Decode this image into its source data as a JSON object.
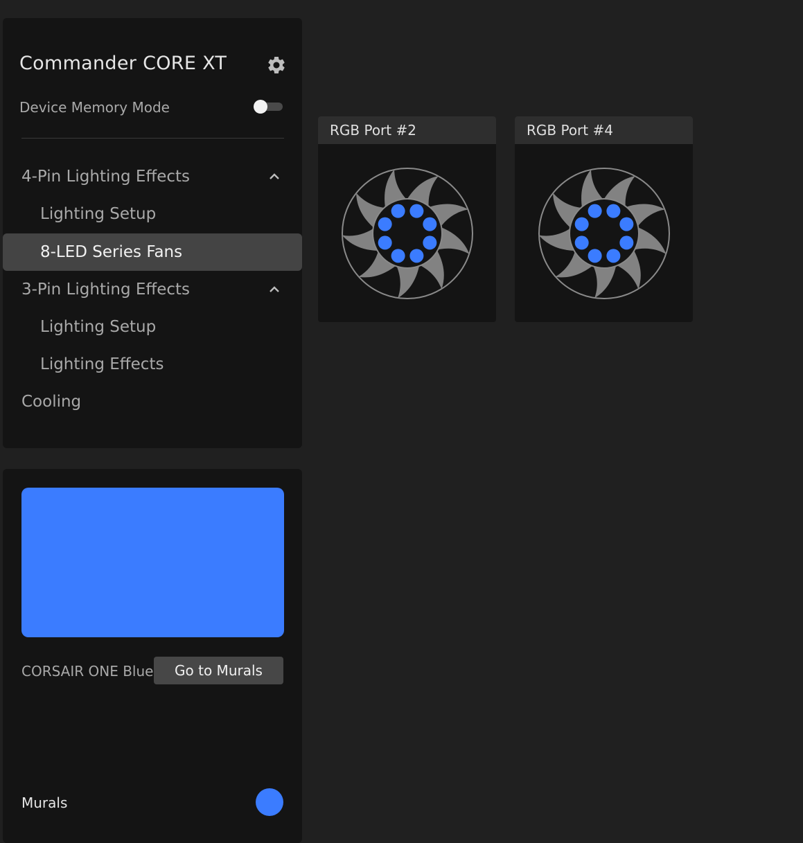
{
  "device": {
    "title": "Commander CORE XT",
    "memory_mode_label": "Device Memory Mode",
    "memory_mode_on": false
  },
  "nav": {
    "items": [
      {
        "label": "4-Pin Lighting Effects",
        "kind": "section",
        "expanded": true
      },
      {
        "label": "Lighting Setup",
        "kind": "sub"
      },
      {
        "label": "8-LED Series Fans",
        "kind": "sub",
        "active": true
      },
      {
        "label": "3-Pin Lighting Effects",
        "kind": "section",
        "expanded": true
      },
      {
        "label": "Lighting Setup",
        "kind": "sub"
      },
      {
        "label": "Lighting Effects",
        "kind": "sub"
      },
      {
        "label": "Cooling",
        "kind": "section"
      }
    ]
  },
  "color": {
    "name": "CORSAIR ONE Blue",
    "hex": "#3b7cff",
    "go_button_label": "Go to Murals"
  },
  "murals": {
    "label": "Murals"
  },
  "ports": [
    {
      "label": "RGB Port #2",
      "led_count": 8
    },
    {
      "label": "RGB Port #4",
      "led_count": 8
    }
  ],
  "colors": {
    "background": "#202020",
    "panel": "#141414",
    "accent": "#3b7cff",
    "active_item": "#444444"
  },
  "icons": {
    "settings": "gear-icon",
    "collapse": "chevron-up-icon",
    "fan": "fan-icon"
  }
}
